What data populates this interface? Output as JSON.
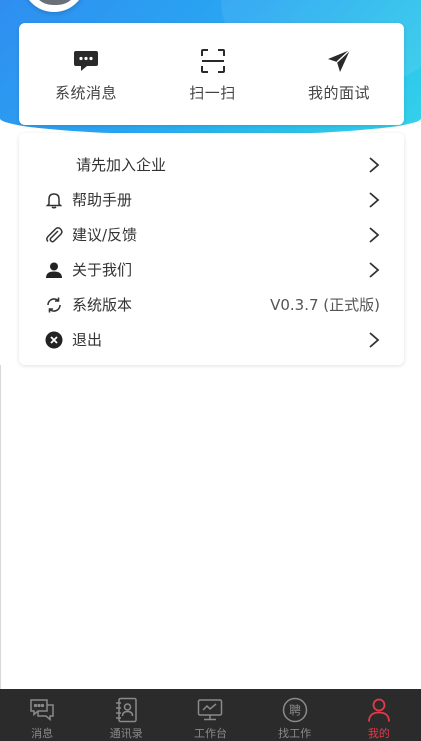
{
  "quick_actions": [
    {
      "label": "系统消息",
      "icon": "chat-bubble-icon"
    },
    {
      "label": "扫一扫",
      "icon": "scan-icon"
    },
    {
      "label": "我的面试",
      "icon": "send-icon"
    }
  ],
  "menu": {
    "join_company": "请先加入企业",
    "help_manual": "帮助手册",
    "feedback": "建议/反馈",
    "about_us": "关于我们",
    "system_version": "系统版本",
    "version_value": "V0.3.7 (正式版)",
    "logout": "退出"
  },
  "tabs": [
    {
      "label": "消息",
      "icon": "message-icon",
      "active": false
    },
    {
      "label": "通讯录",
      "icon": "contacts-icon",
      "active": false
    },
    {
      "label": "工作台",
      "icon": "workbench-icon",
      "active": false
    },
    {
      "label": "找工作",
      "icon": "job-icon",
      "active": false
    },
    {
      "label": "我的",
      "icon": "profile-icon",
      "active": true
    }
  ],
  "colors": {
    "header_gradient_start": "#2f8ef0",
    "header_gradient_end": "#35d2ea",
    "tabbar_bg": "#2b2b2b",
    "active_tab": "#e23a47"
  }
}
